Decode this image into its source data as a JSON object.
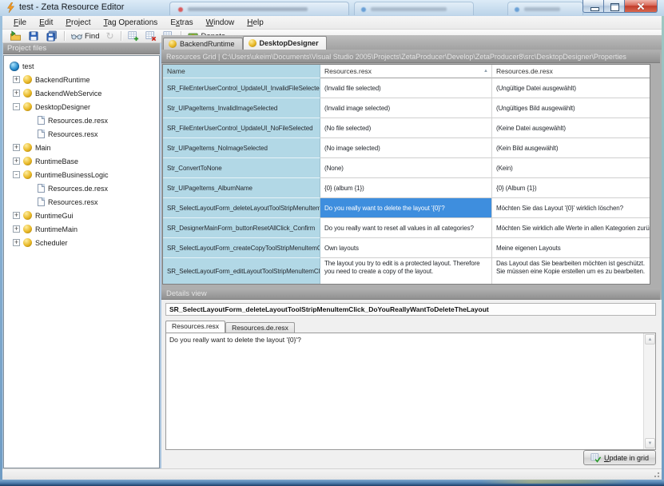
{
  "window": {
    "title": "test - Zeta Resource Editor"
  },
  "menu": [
    {
      "label": "File",
      "accel": 0
    },
    {
      "label": "Edit",
      "accel": 0
    },
    {
      "label": "Project",
      "accel": 0
    },
    {
      "label": "Tag Operations",
      "accel": 0
    },
    {
      "label": "Extras",
      "accel": 1
    },
    {
      "label": "Window",
      "accel": 0
    },
    {
      "label": "Help",
      "accel": 0
    }
  ],
  "toolbar": {
    "find": {
      "label": "Find"
    },
    "donate": {
      "label": "Donate",
      "accel": 0
    }
  },
  "icons": {
    "sort_asc": "▲",
    "scroll_up": "▲",
    "scroll_down": "▼",
    "refresh": "↻"
  },
  "project_panel": {
    "header": "Project files",
    "tree": [
      {
        "label": "test",
        "icon": "globe",
        "level": 0,
        "expander": ""
      },
      {
        "label": "BackendRuntime",
        "icon": "package",
        "level": 1,
        "expander": "+"
      },
      {
        "label": "BackendWebService",
        "icon": "package",
        "level": 1,
        "expander": "+"
      },
      {
        "label": "DesktopDesigner",
        "icon": "package",
        "level": 1,
        "expander": "-"
      },
      {
        "label": "Resources.de.resx",
        "icon": "file",
        "level": 2,
        "expander": ""
      },
      {
        "label": "Resources.resx",
        "icon": "file",
        "level": 2,
        "expander": ""
      },
      {
        "label": "Main",
        "icon": "package",
        "level": 1,
        "expander": "+"
      },
      {
        "label": "RuntimeBase",
        "icon": "package",
        "level": 1,
        "expander": "+"
      },
      {
        "label": "RuntimeBusinessLogic",
        "icon": "package",
        "level": 1,
        "expander": "-"
      },
      {
        "label": "Resources.de.resx",
        "icon": "file",
        "level": 2,
        "expander": ""
      },
      {
        "label": "Resources.resx",
        "icon": "file",
        "level": 2,
        "expander": ""
      },
      {
        "label": "RuntimeGui",
        "icon": "package",
        "level": 1,
        "expander": "+"
      },
      {
        "label": "RuntimeMain",
        "icon": "package",
        "level": 1,
        "expander": "+"
      },
      {
        "label": "Scheduler",
        "icon": "package",
        "level": 1,
        "expander": "+"
      }
    ]
  },
  "document_tabs": [
    {
      "label": "BackendRuntime",
      "active": false
    },
    {
      "label": "DesktopDesigner",
      "active": true
    }
  ],
  "grid": {
    "header": "Resources Grid  |  C:\\Users\\ukeim\\Documents\\Visual Studio 2005\\Projects\\ZetaProducer\\Develop\\ZetaProducer8\\src\\DesktopDesigner\\Properties",
    "columns": [
      {
        "label": "Name"
      },
      {
        "label": "Resources.resx",
        "sort": "ascending"
      },
      {
        "label": "Resources.de.resx"
      }
    ],
    "rows": [
      {
        "name": "SR_FileEnterUserControl_UpdateUI_InvalidFileSelected",
        "en": "(Invalid file selected)",
        "de": "(Ungültige Datei ausgewählt)"
      },
      {
        "name": "Str_UIPageItems_InvalidImageSelected",
        "en": "(Invalid image selected)",
        "de": "(Ungültiges Bild ausgewählt)"
      },
      {
        "name": "SR_FileEnterUserControl_UpdateUI_NoFileSelected",
        "en": "(No file selected)",
        "de": "(Keine Datei ausgewählt)"
      },
      {
        "name": "Str_UIPageItems_NoImageSelected",
        "en": "(No image selected)",
        "de": "(Kein Bild ausgewählt)"
      },
      {
        "name": "Str_ConvertToNone",
        "en": "(None)",
        "de": "(Kein)"
      },
      {
        "name": "Str_UIPageItems_AlbumName",
        "en": "{0} (album {1})",
        "de": "{0} (Album {1})"
      },
      {
        "name": "SR_SelectLayoutForm_deleteLayoutToolStripMenuItemClick_DoYouReallyWantToDeleteTheLayout",
        "en": "Do you really want to delete the layout '{0}'?",
        "de": "Möchten Sie das Layout '{0}' wirklich löschen?",
        "selected_cell": "en"
      },
      {
        "name": "SR_DesignerMainForm_buttonResetAllClick_Confirm",
        "en": "Do you really want to reset all values in all categories?",
        "de": "Möchten Sie wirklich alle Werte in allen Kategorien zurücksetzen?"
      },
      {
        "name": "SR_SelectLayoutForm_createCopyToolStripMenuItemClick_OwnL",
        "en": "Own layouts",
        "de": "Meine eigenen Layouts"
      },
      {
        "name": "SR_SelectLayoutForm_editLayoutToolStripMenuItemClick_MustC",
        "en": "The layout you try to edit is a protected layout. Therefore you need to create a copy of the layout.",
        "de": "Das Layout das Sie bearbeiten möchten ist geschützt. Sie müssen eine Kopie erstellen um es zu bearbeiten."
      }
    ]
  },
  "details": {
    "header": "Details view",
    "resource_name": "SR_SelectLayoutForm_deleteLayoutToolStripMenuItemClick_DoYouReallyWantToDeleteTheLayout",
    "tabs": [
      {
        "label": "Resources.resx",
        "active": true
      },
      {
        "label": "Resources.de.resx",
        "active": false
      }
    ],
    "value": "Do you really want to delete the layout '{0}'?",
    "update_button": {
      "label": "Update in grid",
      "accel": 0
    }
  },
  "colors": {
    "selection": "#3e8ede",
    "name_column": "#b2d8e6",
    "aero_glass": "#b7cfe6",
    "panel_header": "#9a9a9a"
  }
}
